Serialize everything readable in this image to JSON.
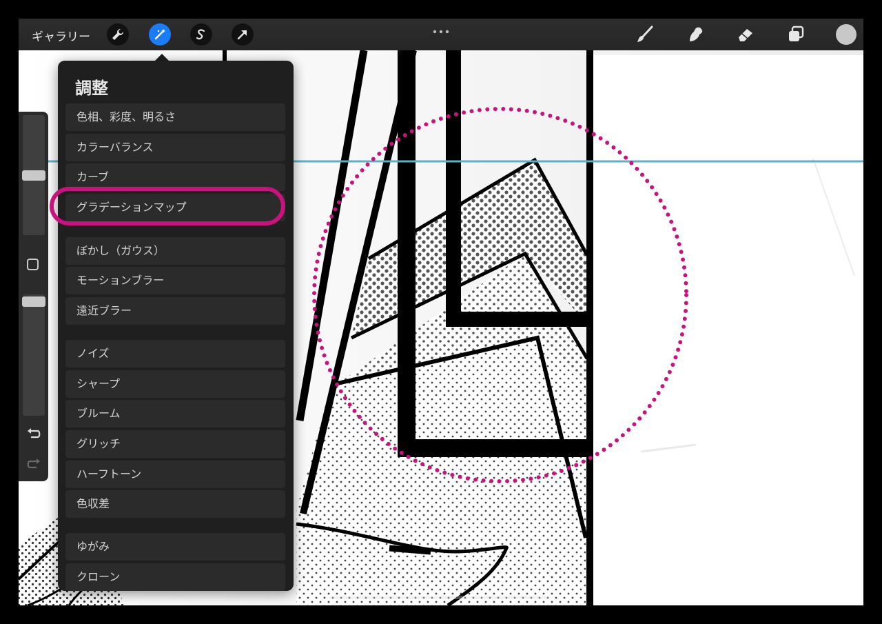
{
  "topbar": {
    "gallery_label": "ギャラリー",
    "more_icon": "more-dots-icon",
    "left_tools": [
      {
        "name": "actions",
        "icon": "wrench-icon",
        "active": false
      },
      {
        "name": "adjustments",
        "icon": "magic-wand-icon",
        "active": true
      },
      {
        "name": "selection",
        "icon": "selection-s-icon",
        "active": false
      },
      {
        "name": "transform",
        "icon": "arrow-cursor-icon",
        "active": false
      }
    ],
    "right_tools": [
      {
        "name": "brush",
        "icon": "brush-icon"
      },
      {
        "name": "smudge",
        "icon": "smudge-icon"
      },
      {
        "name": "eraser",
        "icon": "eraser-icon"
      },
      {
        "name": "layers",
        "icon": "layers-icon"
      },
      {
        "name": "color",
        "icon": "color-swatch-icon",
        "color": "#c8c8c8"
      }
    ],
    "active_color": "#1a7cf6"
  },
  "sidebar": {
    "size_slider_level": 0.5,
    "opacity_slider_level": 0.02,
    "modify_icon": "square-modify-icon",
    "undo_icon": "undo-icon",
    "redo_icon": "redo-icon"
  },
  "adjustments_panel": {
    "title": "調整",
    "groups": [
      [
        "色相、彩度、明るさ",
        "カラーバランス",
        "カーブ",
        "グラデーションマップ"
      ],
      [
        "ぼかし（ガウス）",
        "モーションブラー",
        "遠近ブラー"
      ],
      [
        "ノイズ",
        "シャープ",
        "ブルーム",
        "グリッチ",
        "ハーフトーン",
        "色収差"
      ],
      [
        "ゆがみ",
        "クローン"
      ]
    ],
    "highlighted_item": "グラデーションマップ",
    "highlight_color": "#c8127e"
  },
  "canvas": {
    "guide_color": "#5fb0c0",
    "circle_color": "#c8127e"
  }
}
